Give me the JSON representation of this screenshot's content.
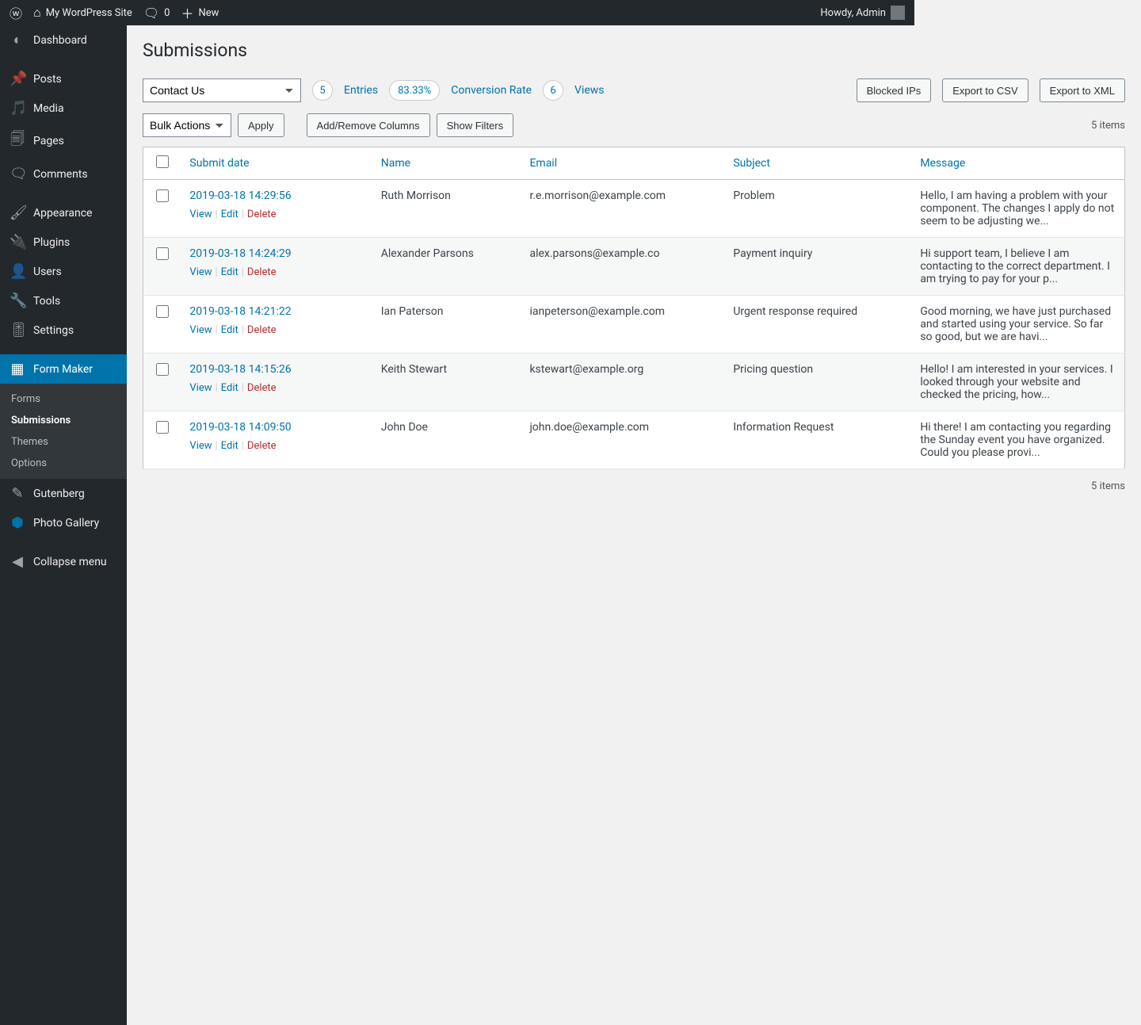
{
  "adminbar": {
    "site_name": "My WordPress Site",
    "comments_count": "0",
    "new_label": "New",
    "howdy_label": "Howdy, Admin"
  },
  "menu": {
    "dashboard": "Dashboard",
    "posts": "Posts",
    "media": "Media",
    "pages": "Pages",
    "comments": "Comments",
    "appearance": "Appearance",
    "plugins": "Plugins",
    "users": "Users",
    "tools": "Tools",
    "settings": "Settings",
    "form_maker": "Form Maker",
    "gutenberg": "Gutenberg",
    "photo_gallery": "Photo Gallery",
    "collapse": "Collapse menu"
  },
  "submenu": {
    "forms": "Forms",
    "submissions": "Submissions",
    "themes": "Themes",
    "options": "Options"
  },
  "page": {
    "title": "Submissions",
    "form_selected": "Contact Us",
    "entries_count": "5",
    "entries_label": "Entries",
    "conversion_value": "83.33%",
    "conversion_label": "Conversion Rate",
    "views_count": "6",
    "views_label": "Views",
    "blocked_ips_btn": "Blocked IPs",
    "export_csv_btn": "Export to CSV",
    "export_xml_btn": "Export to XML",
    "bulk_label": "Bulk Actions",
    "apply_btn": "Apply",
    "columns_btn": "Add/Remove Columns",
    "filters_btn": "Show Filters",
    "items_count": "5 items"
  },
  "actions": {
    "view": "View",
    "edit": "Edit",
    "delete": "Delete"
  },
  "columns": {
    "date": "Submit date",
    "name": "Name",
    "email": "Email",
    "subject": "Subject",
    "message": "Message"
  },
  "rows": [
    {
      "date": "2019-03-18 14:29:56",
      "name": "Ruth Morrison",
      "email": "r.e.morrison@example.com",
      "subject": "Problem",
      "message": "Hello, I am having a problem with your component. The changes I apply do not seem to be adjusting we..."
    },
    {
      "date": "2019-03-18 14:24:29",
      "name": "Alexander Parsons",
      "email": "alex.parsons@example.co",
      "subject": "Payment inquiry",
      "message": "Hi support team, I believe I am contacting to the correct department. I am trying to pay for your p..."
    },
    {
      "date": "2019-03-18 14:21:22",
      "name": "Ian Paterson",
      "email": "ianpeterson@example.com",
      "subject": "Urgent response required",
      "message": "Good morning, we have just purchased and started using your service. So far so good, but we are havi..."
    },
    {
      "date": "2019-03-18 14:15:26",
      "name": "Keith Stewart",
      "email": "kstewart@example.org",
      "subject": "Pricing question",
      "message": "Hello! I am interested in your services. I looked through your website and checked the pricing, how..."
    },
    {
      "date": "2019-03-18 14:09:50",
      "name": "John Doe",
      "email": "john.doe@example.com",
      "subject": "Information Request",
      "message": "Hi there! I am contacting you regarding the Sunday event you have organized. Could you please provi..."
    }
  ]
}
